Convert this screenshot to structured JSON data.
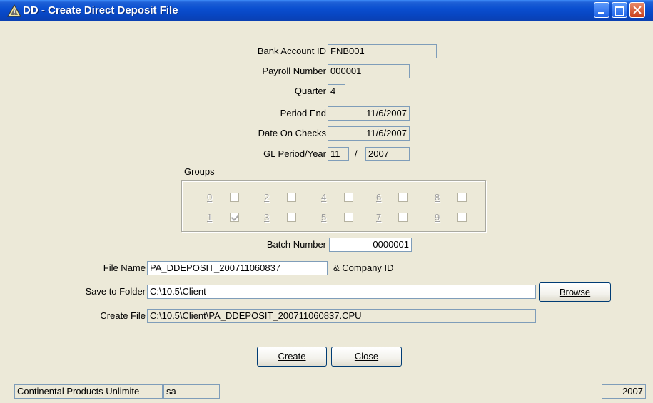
{
  "window": {
    "title": "DD - Create Direct Deposit File",
    "icon": "warning-triangle-icon"
  },
  "form": {
    "bank_account_id": {
      "label": "Bank Account ID",
      "value": "FNB001"
    },
    "payroll_number": {
      "label": "Payroll Number",
      "value": "000001"
    },
    "quarter": {
      "label": "Quarter",
      "value": "4"
    },
    "period_end": {
      "label": "Period End",
      "value": "11/6/2007"
    },
    "date_on_checks": {
      "label": "Date On Checks",
      "value": "11/6/2007"
    },
    "gl_period_year": {
      "label": "GL Period/Year",
      "period": "11",
      "separator": "/",
      "year": "2007"
    },
    "groups": {
      "label": "Groups",
      "items": [
        {
          "number": "0",
          "checked": false
        },
        {
          "number": "1",
          "checked": true
        },
        {
          "number": "2",
          "checked": false
        },
        {
          "number": "3",
          "checked": false
        },
        {
          "number": "4",
          "checked": false
        },
        {
          "number": "5",
          "checked": false
        },
        {
          "number": "6",
          "checked": false
        },
        {
          "number": "7",
          "checked": false
        },
        {
          "number": "8",
          "checked": false
        },
        {
          "number": "9",
          "checked": false
        }
      ]
    },
    "batch_number": {
      "label": "Batch Number",
      "value": "0000001"
    },
    "file_name": {
      "label": "File Name",
      "value": "PA_DDEPOSIT_200711060837",
      "suffix": "& Company ID"
    },
    "save_to_folder": {
      "label": "Save to Folder",
      "value": "C:\\10.5\\Client",
      "browse_label": "Browse"
    },
    "create_file": {
      "label": "Create File",
      "value": "C:\\10.5\\Client\\PA_DDEPOSIT_200711060837.CPU"
    }
  },
  "buttons": {
    "create_label": "Create",
    "close_label": "Close"
  },
  "status_bar": {
    "company": "Continental Products Unlimite",
    "user": "sa",
    "year": "2007"
  },
  "colors": {
    "title_bar": "#0a4fd0",
    "window_bg": "#ece9d8",
    "field_border": "#7f9db9"
  }
}
